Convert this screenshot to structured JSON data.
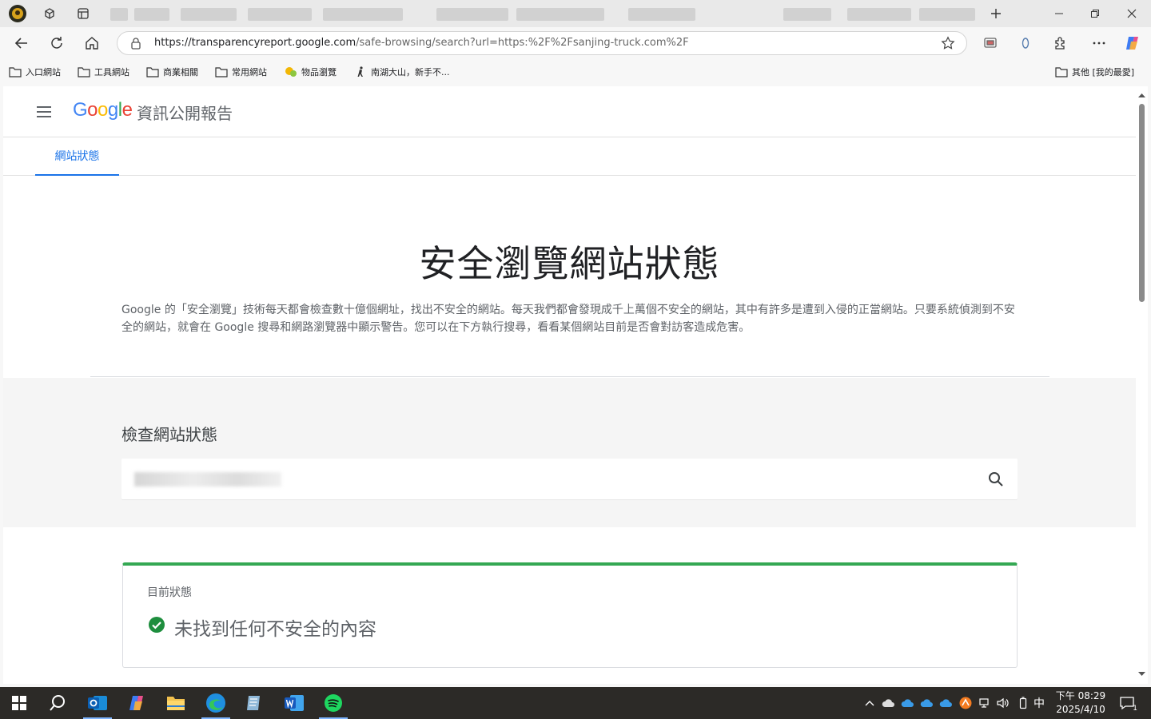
{
  "browser": {
    "omnibox": {
      "url_host": "https://transparencyreport.google.com",
      "url_rest": "/safe-browsing/search?url=https:%2F%2Fsanjing-truck.com%2F"
    },
    "bookmarks": [
      {
        "label": "入口網站"
      },
      {
        "label": "工具網站"
      },
      {
        "label": "商業相關"
      },
      {
        "label": "常用網站"
      },
      {
        "label": "物品瀏覽"
      },
      {
        "label": "南湖大山，新手不..."
      }
    ],
    "bookmarks_other": "其他 [我的最愛]"
  },
  "site": {
    "logo": "Google",
    "title": "資訊公開報告",
    "tab": "網站狀態"
  },
  "hero": {
    "title": "安全瀏覽網站狀態",
    "description": "Google 的「安全瀏覽」技術每天都會檢查數十億個網址，找出不安全的網站。每天我們都會發現成千上萬個不安全的網站，其中有許多是遭到入侵的正當網站。只要系統偵測到不安全的網站，就會在 Google 搜尋和網路瀏覽器中顯示警告。您可以在下方執行搜尋，看看某個網站目前是否會對訪客造成危害。"
  },
  "search": {
    "heading": "檢查網站狀態"
  },
  "status": {
    "label": "目前狀態",
    "result": "未找到任何不安全的內容",
    "color": "#34a853"
  },
  "taskbar": {
    "ime": "中",
    "time": "下午 08:29",
    "date": "2025/4/10",
    "notifications": "1"
  }
}
